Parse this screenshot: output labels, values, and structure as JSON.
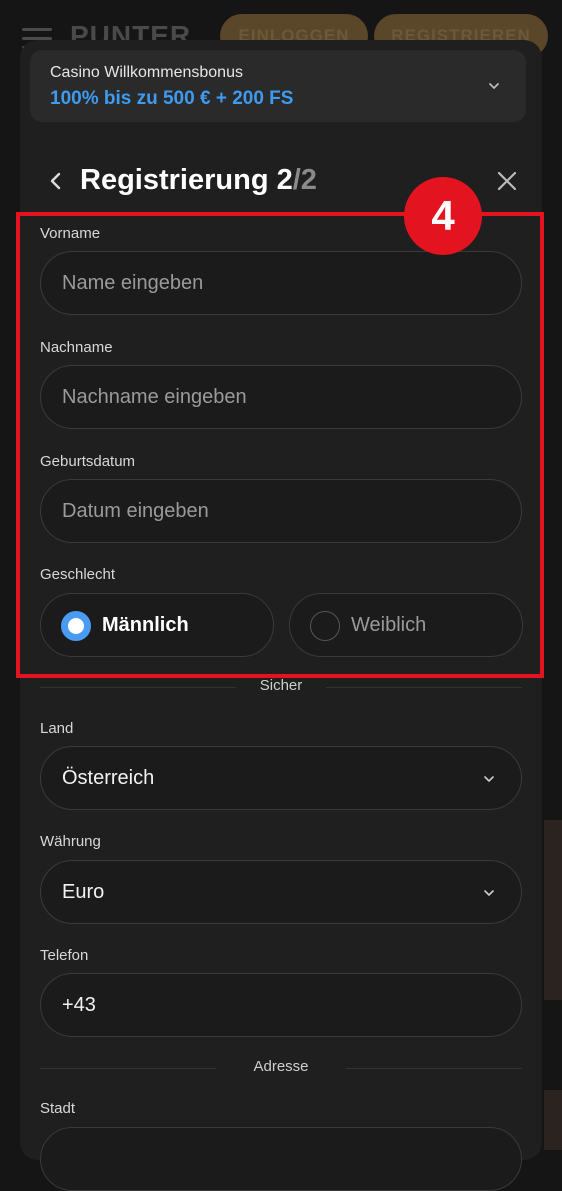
{
  "background_header": {
    "logo_text": "PUNTER",
    "login_label": "EINLOGGEN",
    "register_label": "REGISTRIEREN"
  },
  "bonus": {
    "title": "Casino Willkommensbonus",
    "value": "100% bis zu 500 € + 200 FS",
    "accent_color": "#3d9bf0"
  },
  "modal": {
    "title": "Registrierung 2",
    "step_total": "/2"
  },
  "form": {
    "vorname": {
      "label": "Vorname",
      "placeholder": "Name eingeben"
    },
    "nachname": {
      "label": "Nachname",
      "placeholder": "Nachname eingeben"
    },
    "geburtsdatum": {
      "label": "Geburtsdatum",
      "placeholder": "Datum eingeben"
    },
    "geschlecht": {
      "label": "Geschlecht",
      "options": [
        {
          "label": "Männlich",
          "selected": true
        },
        {
          "label": "Weiblich",
          "selected": false
        }
      ]
    },
    "divider_secure": "Sicher",
    "land": {
      "label": "Land",
      "value": "Österreich"
    },
    "waehrung": {
      "label": "Währung",
      "value": "Euro"
    },
    "telefon": {
      "label": "Telefon",
      "value": "+43"
    },
    "divider_address": "Adresse",
    "stadt": {
      "label": "Stadt"
    }
  },
  "annotation": {
    "badge_number": "4",
    "color": "#e3141f"
  }
}
